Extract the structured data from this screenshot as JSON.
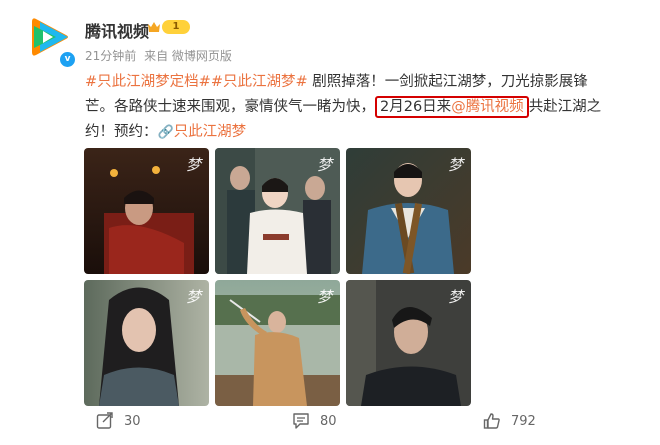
{
  "account": {
    "name": "腾讯视频",
    "level": "1"
  },
  "meta": {
    "time": "21分钟前",
    "source": "来自 微博网页版"
  },
  "post": {
    "tag1": "#只此江湖梦定档#",
    "tag2": "#只此江湖梦#",
    "text1": " 剧照掉落！一剑掀起江湖梦，刀光掠影展锋芒。各路侠士速来围观，豪情侠气一睹为快，",
    "date": "2月26日来",
    "mention": "@腾讯视频",
    "text2": "共赴江湖之约！预约：",
    "link": "只此江湖梦"
  },
  "photos": [
    {
      "mark": "梦"
    },
    {
      "mark": "梦"
    },
    {
      "mark": "梦"
    },
    {
      "mark": "梦"
    },
    {
      "mark": "梦"
    },
    {
      "mark": "梦"
    }
  ],
  "actions": {
    "share": "30",
    "comment": "80",
    "like": "792"
  },
  "colors": {
    "tag": "#eb7340",
    "highlight": "#d40000",
    "verify": "#1da1f2"
  },
  "icons": [
    "tencent-video-logo",
    "verified-icon",
    "crown-icon",
    "link-icon",
    "share-icon",
    "comment-icon",
    "like-icon"
  ]
}
